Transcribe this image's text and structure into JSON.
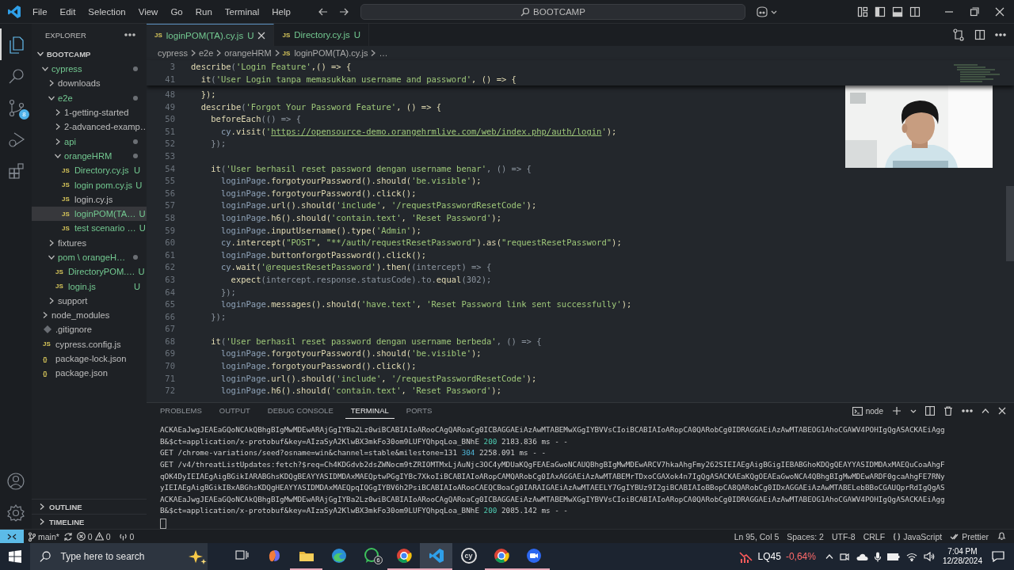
{
  "titlebar": {
    "menu": [
      "File",
      "Edit",
      "Selection",
      "View",
      "Go",
      "Run",
      "Terminal",
      "Help"
    ],
    "command_center": "BOOTCAMP"
  },
  "activity_bar": [
    {
      "kind": "explorer",
      "selected": true
    },
    {
      "kind": "search",
      "selected": false
    },
    {
      "kind": "source-control",
      "selected": false,
      "badge": "8"
    },
    {
      "kind": "run",
      "selected": false
    },
    {
      "kind": "extensions",
      "selected": false
    }
  ],
  "explorer": {
    "title": "EXPLORER",
    "root": {
      "label": "BOOTCAMP",
      "expanded": true,
      "children": [
        {
          "label": "cypress",
          "kind": "folder",
          "expanded": true,
          "changed": true,
          "dot": true,
          "selected": false,
          "children": [
            {
              "label": "downloads",
              "kind": "folder",
              "expanded": false,
              "changed": false,
              "dot": false,
              "selected": false
            },
            {
              "label": "e2e",
              "kind": "folder",
              "expanded": true,
              "changed": true,
              "dot": true,
              "selected": false,
              "children": [
                {
                  "label": "1-getting-started",
                  "kind": "folder",
                  "expanded": false,
                  "changed": false,
                  "dot": false,
                  "selected": false
                },
                {
                  "label": "2-advanced-examp…",
                  "kind": "folder",
                  "expanded": false,
                  "changed": false,
                  "dot": false,
                  "selected": false
                },
                {
                  "label": "api",
                  "kind": "folder",
                  "expanded": false,
                  "changed": true,
                  "dot": true,
                  "selected": false
                },
                {
                  "label": "orangeHRM",
                  "kind": "folder",
                  "expanded": true,
                  "changed": true,
                  "dot": true,
                  "selected": false,
                  "children": [
                    {
                      "label": "Directory.cy.js",
                      "kind": "js",
                      "icon": "JS",
                      "badge": "U",
                      "changed": true,
                      "dot": false,
                      "selected": false
                    },
                    {
                      "label": "login pom.cy.js",
                      "kind": "js",
                      "icon": "JS",
                      "badge": "U",
                      "changed": true,
                      "dot": false,
                      "selected": false
                    },
                    {
                      "label": "login.cy.js",
                      "kind": "js",
                      "icon": "JS",
                      "changed": false,
                      "dot": false,
                      "selected": false
                    },
                    {
                      "label": "loginPOM(TA…",
                      "kind": "js",
                      "icon": "JS",
                      "badge": "U",
                      "changed": true,
                      "dot": false,
                      "selected": true
                    },
                    {
                      "label": "test scenario …",
                      "kind": "js",
                      "icon": "JS",
                      "badge": "U",
                      "changed": true,
                      "dot": false,
                      "selected": false
                    }
                  ]
                }
              ]
            },
            {
              "label": "fixtures",
              "kind": "folder",
              "expanded": false,
              "changed": false,
              "dot": false,
              "selected": false
            },
            {
              "label": "pom \\ orangeH…",
              "kind": "folder",
              "expanded": true,
              "changed": true,
              "dot": true,
              "selected": false,
              "children": [
                {
                  "label": "DirectoryPOM.…",
                  "kind": "js",
                  "icon": "JS",
                  "badge": "U",
                  "changed": true,
                  "dot": false,
                  "selected": false
                },
                {
                  "label": "login.js",
                  "kind": "js",
                  "icon": "JS",
                  "badge": "U",
                  "changed": true,
                  "dot": false,
                  "selected": false
                }
              ]
            },
            {
              "label": "support",
              "kind": "folder",
              "expanded": false,
              "changed": false,
              "dot": false,
              "selected": false
            }
          ]
        },
        {
          "label": "node_modules",
          "kind": "folder",
          "expanded": false,
          "changed": false,
          "dot": false,
          "selected": false
        },
        {
          "label": ".gitignore",
          "kind": "git",
          "changed": false,
          "dot": false,
          "selected": false
        },
        {
          "label": "cypress.config.js",
          "kind": "js",
          "icon": "JS",
          "changed": false,
          "dot": false,
          "selected": false
        },
        {
          "label": "package-lock.json",
          "kind": "json",
          "icon": "{}",
          "changed": false,
          "dot": false,
          "selected": false
        },
        {
          "label": "package.json",
          "kind": "json",
          "icon": "{}",
          "changed": false,
          "dot": false,
          "selected": false
        }
      ]
    },
    "sections": [
      {
        "label": "OUTLINE",
        "expanded": false
      },
      {
        "label": "TIMELINE",
        "expanded": false
      }
    ]
  },
  "tabs": [
    {
      "icon": "JS",
      "label": "loginPOM(TA).cy.js",
      "status": "U",
      "selected": true
    },
    {
      "icon": "JS",
      "label": "Directory.cy.js",
      "status": "U",
      "selected": false
    }
  ],
  "breadcrumb": [
    {
      "kind": "folder",
      "label": "cypress"
    },
    {
      "kind": "folder",
      "label": "e2e"
    },
    {
      "kind": "folder",
      "label": "orangeHRM"
    },
    {
      "kind": "file",
      "icon": "JS",
      "label": "loginPOM(TA).cy.js"
    },
    {
      "kind": "more",
      "label": "…"
    }
  ],
  "editor": {
    "sticky_lines": [
      {
        "number": "3",
        "tokens": [
          {
            "text": "describe",
            "kind": "fn"
          },
          {
            "text": "(",
            "kind": "dim"
          },
          {
            "text": "'Login Feature'",
            "kind": "str"
          },
          {
            "text": ",() => {",
            "kind": "fn"
          }
        ]
      },
      {
        "number": "41",
        "tokens": [
          {
            "text": "  it",
            "kind": "fn"
          },
          {
            "text": "(",
            "kind": "dim"
          },
          {
            "text": "'User Login tanpa memasukkan username and password'",
            "kind": "str"
          },
          {
            "text": ", () => {",
            "kind": "fn"
          }
        ]
      }
    ],
    "lines": [
      {
        "number": "48",
        "tokens": [
          {
            "text": "  });",
            "kind": "fn"
          }
        ]
      },
      {
        "number": "49",
        "tokens": [
          {
            "text": "  describe",
            "kind": "fn"
          },
          {
            "text": "(",
            "kind": "dim"
          },
          {
            "text": "'Forgot Your Password Feature'",
            "kind": "str"
          },
          {
            "text": ", () => {",
            "kind": "fn"
          }
        ]
      },
      {
        "number": "50",
        "tokens": [
          {
            "text": "    beforeEach",
            "kind": "fn"
          },
          {
            "text": "(() => {",
            "kind": "dim"
          }
        ]
      },
      {
        "number": "51",
        "tokens": [
          {
            "text": "      cy",
            "kind": "obj"
          },
          {
            "text": ".visit(",
            "kind": "fn"
          },
          {
            "text": "'",
            "kind": "str"
          },
          {
            "text": "https://opensource-demo.orangehrmlive.com/web/index.php/auth/login",
            "kind": "link"
          },
          {
            "text": "'",
            "kind": "str"
          },
          {
            "text": ");",
            "kind": "fn"
          }
        ]
      },
      {
        "number": "52",
        "tokens": [
          {
            "text": "    });",
            "kind": "dim"
          }
        ]
      },
      {
        "number": "53"
      },
      {
        "number": "54",
        "tokens": [
          {
            "text": "    it",
            "kind": "fn"
          },
          {
            "text": "(",
            "kind": "dim"
          },
          {
            "text": "'User berhasil reset password dengan username benar'",
            "kind": "str"
          },
          {
            "text": ", () => {",
            "kind": "dim"
          }
        ]
      },
      {
        "number": "55",
        "tokens": [
          {
            "text": "      loginPage",
            "kind": "obj"
          },
          {
            "text": ".forgotyourPassword().should(",
            "kind": "fn"
          },
          {
            "text": "'be.visible'",
            "kind": "str"
          },
          {
            "text": ");",
            "kind": "fn"
          }
        ]
      },
      {
        "number": "56",
        "tokens": [
          {
            "text": "      loginPage",
            "kind": "obj"
          },
          {
            "text": ".forgotyourPassword().click();",
            "kind": "fn"
          }
        ]
      },
      {
        "number": "57",
        "tokens": [
          {
            "text": "      loginPage",
            "kind": "obj"
          },
          {
            "text": ".url().should(",
            "kind": "fn"
          },
          {
            "text": "'include'",
            "kind": "str"
          },
          {
            "text": ", ",
            "kind": "fn"
          },
          {
            "text": "'/requestPasswordResetCode'",
            "kind": "str"
          },
          {
            "text": ");",
            "kind": "fn"
          }
        ]
      },
      {
        "number": "58",
        "tokens": [
          {
            "text": "      loginPage",
            "kind": "obj"
          },
          {
            "text": ".h6().should(",
            "kind": "fn"
          },
          {
            "text": "'contain.text'",
            "kind": "str"
          },
          {
            "text": ", ",
            "kind": "fn"
          },
          {
            "text": "'Reset Password'",
            "kind": "str"
          },
          {
            "text": ");",
            "kind": "fn"
          }
        ]
      },
      {
        "number": "59",
        "tokens": [
          {
            "text": "      loginPage",
            "kind": "obj"
          },
          {
            "text": ".inputUsername().type(",
            "kind": "fn"
          },
          {
            "text": "'Admin'",
            "kind": "str"
          },
          {
            "text": ");",
            "kind": "fn"
          }
        ]
      },
      {
        "number": "60",
        "tokens": [
          {
            "text": "      cy",
            "kind": "obj"
          },
          {
            "text": ".intercept(",
            "kind": "fn"
          },
          {
            "text": "\"POST\"",
            "kind": "str"
          },
          {
            "text": ", ",
            "kind": "fn"
          },
          {
            "text": "\"**/auth/requestResetPassword\"",
            "kind": "str"
          },
          {
            "text": ").as(",
            "kind": "fn"
          },
          {
            "text": "\"requestResetPassword\"",
            "kind": "str"
          },
          {
            "text": ");",
            "kind": "fn"
          }
        ]
      },
      {
        "number": "61",
        "tokens": [
          {
            "text": "      loginPage",
            "kind": "obj"
          },
          {
            "text": ".buttonforgotPassword().click();",
            "kind": "fn"
          }
        ]
      },
      {
        "number": "62",
        "tokens": [
          {
            "text": "      cy",
            "kind": "obj"
          },
          {
            "text": ".wait(",
            "kind": "fn"
          },
          {
            "text": "'@requestResetPassword'",
            "kind": "str"
          },
          {
            "text": ").then(",
            "kind": "fn"
          },
          {
            "text": "(intercept) => {",
            "kind": "dim"
          }
        ]
      },
      {
        "number": "63",
        "tokens": [
          {
            "text": "        expect",
            "kind": "fn"
          },
          {
            "text": "(intercept.response.statusCode).to.",
            "kind": "dim"
          },
          {
            "text": "equal",
            "kind": "fn"
          },
          {
            "text": "(302);",
            "kind": "dim"
          }
        ]
      },
      {
        "number": "64",
        "tokens": [
          {
            "text": "      });",
            "kind": "dim"
          }
        ]
      },
      {
        "number": "65",
        "tokens": [
          {
            "text": "      loginPage",
            "kind": "obj"
          },
          {
            "text": ".messages().should(",
            "kind": "fn"
          },
          {
            "text": "'have.text'",
            "kind": "str"
          },
          {
            "text": ", ",
            "kind": "fn"
          },
          {
            "text": "'Reset Password link sent successfully'",
            "kind": "str"
          },
          {
            "text": ");",
            "kind": "fn"
          }
        ]
      },
      {
        "number": "66",
        "tokens": [
          {
            "text": "    });",
            "kind": "dim"
          }
        ]
      },
      {
        "number": "67"
      },
      {
        "number": "68",
        "tokens": [
          {
            "text": "    it",
            "kind": "fn"
          },
          {
            "text": "(",
            "kind": "dim"
          },
          {
            "text": "'User berhasil reset password dengan username berbeda'",
            "kind": "str"
          },
          {
            "text": ", () => {",
            "kind": "dim"
          }
        ]
      },
      {
        "number": "69",
        "tokens": [
          {
            "text": "      loginPage",
            "kind": "obj"
          },
          {
            "text": ".forgotyourPassword().should(",
            "kind": "fn"
          },
          {
            "text": "'be.visible'",
            "kind": "str"
          },
          {
            "text": ");",
            "kind": "fn"
          }
        ]
      },
      {
        "number": "70",
        "tokens": [
          {
            "text": "      loginPage",
            "kind": "obj"
          },
          {
            "text": ".forgotyourPassword().click();",
            "kind": "fn"
          }
        ]
      },
      {
        "number": "71",
        "tokens": [
          {
            "text": "      loginPage",
            "kind": "obj"
          },
          {
            "text": ".url().should(",
            "kind": "fn"
          },
          {
            "text": "'include'",
            "kind": "str"
          },
          {
            "text": ", ",
            "kind": "fn"
          },
          {
            "text": "'/requestPasswordResetCode'",
            "kind": "str"
          },
          {
            "text": ");",
            "kind": "fn"
          }
        ]
      },
      {
        "number": "72",
        "tokens": [
          {
            "text": "      loginPage",
            "kind": "obj"
          },
          {
            "text": ".h6().should(",
            "kind": "fn"
          },
          {
            "text": "'contain.text'",
            "kind": "str"
          },
          {
            "text": ", ",
            "kind": "fn"
          },
          {
            "text": "'Reset Password'",
            "kind": "str"
          },
          {
            "text": ");",
            "kind": "fn"
          }
        ]
      }
    ]
  },
  "panel": {
    "tabs": [
      {
        "label": "PROBLEMS",
        "selected": false
      },
      {
        "label": "OUTPUT",
        "selected": false
      },
      {
        "label": "DEBUG CONSOLE",
        "selected": false
      },
      {
        "label": "TERMINAL",
        "selected": true
      },
      {
        "label": "PORTS",
        "selected": false
      }
    ],
    "terminal_name": "node",
    "terminal_lines": [
      [
        {
          "text": "ACKAEaJwgJEAEaGQoNCAkQBhgBIgMwMDEwARAjGgIYBa2Lz0wiBCABIAIoARooCAgQARoaCg0ICBAGGAEiAzAwMTABEMwXGgIYBVVsCIoiBCABIAIoARopCA0QARobCg0IDRAGGAEiAzAwMTABEOG1AhoCGAWV4POHIgQgASACKAEiAgg",
          "kind": "plain"
        }
      ],
      [
        {
          "text": "B&$ct=application/x-protobuf&key=AIzaSyA2KlwBX3mkFo30om9LUFYQhpqLoa_BNhE ",
          "kind": "plain"
        },
        {
          "text": "200",
          "kind": "ok"
        },
        {
          "text": " 2183.836 ms - -",
          "kind": "plain"
        }
      ],
      [
        {
          "text": "GET /chrome-variations/seed?osname=win&channel=stable&milestone=131 ",
          "kind": "plain"
        },
        {
          "text": "304",
          "kind": "info"
        },
        {
          "text": " 2258.091 ms - -",
          "kind": "plain"
        }
      ],
      [
        {
          "text": "GET /v4/threatListUpdates:fetch?$req=Ch4KDGdvb2dsZWNocm9tZRIOMTMxLjAuNjc3OC4yMDUaKQgFEAEaGwoNCAUQBhgBIgMwMDEwARCV7hkaAhgFmy262SIEIAEgAigBGigIEBABGhoKDQgQEAYYASIDMDAxMAEQuCoaAhgF",
          "kind": "plain"
        }
      ],
      [
        {
          "text": "qOK4DyIEIAEgAigBGikIARABGhsKDQgBEAYYASIDMDAxMAEQptwPGgIYBc7XkoIiBCABIAIoARopCAMQARobCg0IAxAGGAEiAzAwMTABEMrTDxoCGAXok4n7IgQgASACKAEaKQgOEAEaGwoNCA4QBhgBIgMwMDEwARDF0gcaAhgFE7RNy",
          "kind": "plain"
        }
      ],
      [
        {
          "text": "yIEIAEgAigBGikIBxABGhsKDQgHEAYYASIDMDAxMAEQpqIQGgIYBV6h2PsiBCABIAIoARooCAEQCBoaCg0IARAIGAEiAzAwMTAEELY7GgIYBUz9I2giBCABIAIoBBopCA8QARobCg0IDxAGGAEiAzAwMTABELebBBoCGAUQprRdIgQgAS",
          "kind": "plain"
        }
      ],
      [
        {
          "text": "ACKAEaJwgJEAEaGQoNCAkQBhgBIgMwMDEwARAjGgIYBa2Lz0wiBCABIAIoARooCAgQARoaCg0ICBAGGAEiAzAwMTABEMwXGgIYBVVsCIoiBCABIAIoARopCA0QARobCg0IDRAGGAEiAzAwMTABEOG1AhoCGAWV4POHIgQgASACKAEiAgg",
          "kind": "plain"
        }
      ],
      [
        {
          "text": "B&$ct=application/x-protobuf&key=AIzaSyA2KlwBX3mkFo30om9LUFYQhpqLoa_BNhE ",
          "kind": "plain"
        },
        {
          "text": "200",
          "kind": "ok"
        },
        {
          "text": " 2085.142 ms - -",
          "kind": "plain"
        }
      ]
    ]
  },
  "status_bar": {
    "branch": "main*",
    "errors": "0",
    "warnings": "0",
    "ports": "0",
    "position": "Ln 95, Col 5",
    "indent": "Spaces: 2",
    "encoding": "UTF-8",
    "eol": "CRLF",
    "language": "JavaScript",
    "formatter": "Prettier"
  },
  "taskbar": {
    "search_placeholder": "Type here to search",
    "apps": [
      {
        "kind": "task-view",
        "running": false,
        "selected": false
      },
      {
        "kind": "swirl",
        "running": false,
        "selected": false
      },
      {
        "kind": "folder",
        "running": true,
        "selected": false
      },
      {
        "kind": "wave",
        "running": false,
        "selected": false
      },
      {
        "kind": "chat",
        "running": false,
        "selected": false,
        "badge": "6"
      },
      {
        "kind": "chrome",
        "running": true,
        "selected": false
      },
      {
        "kind": "code",
        "running": true,
        "selected": true
      },
      {
        "kind": "cy",
        "label": "cy",
        "running": false,
        "selected": false
      },
      {
        "kind": "chrome",
        "running": true,
        "selected": false
      },
      {
        "kind": "video",
        "running": true,
        "selected": false
      }
    ],
    "stock": {
      "symbol": "LQ45",
      "change": "-0,64%"
    },
    "time": "7:04 PM",
    "date": "12/28/2024"
  }
}
